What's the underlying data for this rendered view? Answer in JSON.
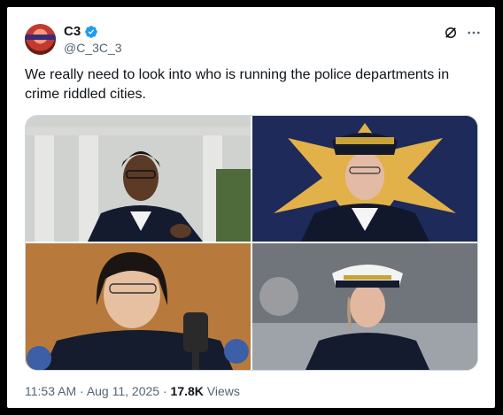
{
  "author": {
    "display_name": "C3",
    "handle": "@C_3C_3",
    "verified": true,
    "avatar_icon": "avatar-portrait"
  },
  "header_icons": [
    "grok-icon",
    "more-options-icon"
  ],
  "tweet": {
    "text": "We really need to look into who is running the police departments in crime riddled cities."
  },
  "media": {
    "image_count": 4,
    "images": [
      {
        "name": "photo-1"
      },
      {
        "name": "photo-2"
      },
      {
        "name": "photo-3"
      },
      {
        "name": "photo-4"
      }
    ]
  },
  "meta": {
    "time": "11:53 AM",
    "separator": "·",
    "date": "Aug 11, 2025",
    "views_count": "17.8K",
    "views_label": "Views"
  },
  "colors": {
    "verified_blue": "#1d9bf0",
    "text_primary": "#0f1419",
    "text_secondary": "#536471",
    "frame": "#000000"
  }
}
